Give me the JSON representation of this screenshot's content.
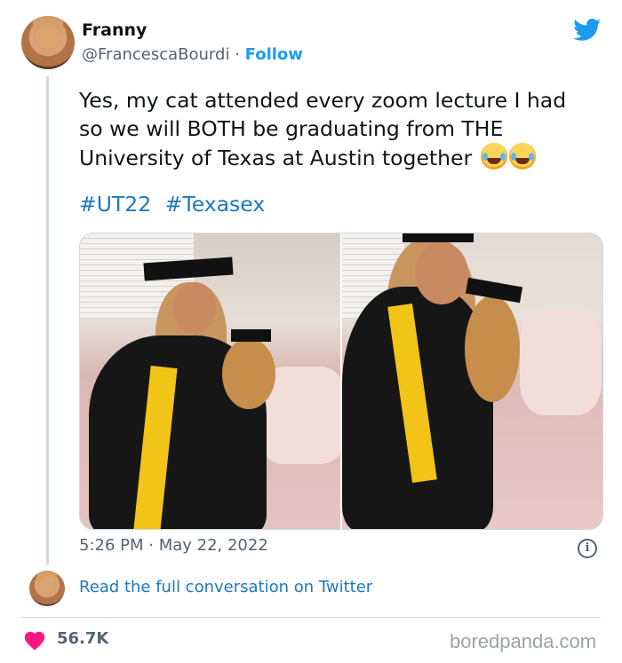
{
  "user": {
    "display_name": "Franny",
    "handle": "@FrancescaBourdi",
    "separator": "·",
    "follow_label": "Follow"
  },
  "tweet": {
    "text": "Yes, my cat attended every zoom lecture I had so we will BOTH be graduating from THE University of Texas at Austin together",
    "emoji": [
      "joy-tears-emoji",
      "joy-tears-emoji"
    ],
    "hashtags": [
      "#UT22",
      "#Texasex"
    ],
    "timestamp": "5:26 PM · May 22, 2022"
  },
  "thread": {
    "read_more_label": "Read the full conversation on Twitter"
  },
  "engagement": {
    "likes": "56.7K"
  },
  "watermark": "boredpanda.com",
  "colors": {
    "accent": "#1d9bf0",
    "link": "#1d77c0",
    "heart": "#f91880",
    "muted": "#536471"
  },
  "icons": {
    "brand": "twitter-bird-icon",
    "info": "info-icon",
    "like": "heart-icon"
  }
}
